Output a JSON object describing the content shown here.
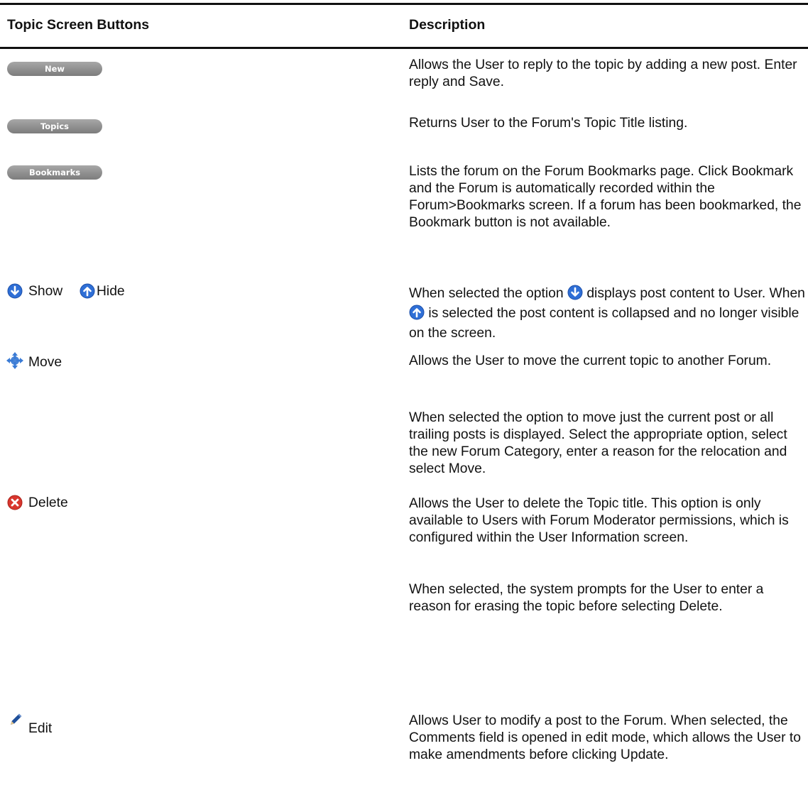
{
  "table": {
    "header": {
      "col1": "Topic Screen Buttons",
      "col2": "Description"
    },
    "rows": {
      "new": {
        "button_label": "New",
        "desc": "Allows the User to reply to the topic by adding a new post. Enter reply and Save."
      },
      "topics": {
        "button_label": "Topics",
        "desc": "Returns User to the Forum's Topic Title listing."
      },
      "bookmarks": {
        "button_label": "Bookmarks",
        "desc": "Lists the forum on the Forum Bookmarks page. Click Bookmark and the Forum is automatically recorded within the Forum>Bookmarks screen. If a forum has been bookmarked, the Bookmark button is not available."
      },
      "show_hide": {
        "show_label": "Show",
        "hide_label": "Hide",
        "desc_a": "When selected the option",
        "desc_b": "displays post content to User. When",
        "desc_c": "is selected the post content is collapsed and no longer visible on the screen."
      },
      "move": {
        "label": "Move",
        "desc": "Allows the User to move the current topic to another Forum.",
        "desc2": "When selected the option to move just the current post or all trailing posts is displayed. Select the appropriate option, select the new Forum Category, enter a reason for the relocation and select Move."
      },
      "delete": {
        "label": "Delete",
        "desc": "Allows the User to delete the Topic title. This option is only available to Users with Forum Moderator permissions, which is configured within the User Information screen.",
        "desc2": "When selected, the system prompts for the User to enter a reason for erasing the topic before selecting Delete."
      },
      "edit": {
        "label": "Edit",
        "desc": "Allows User to modify a post to the Forum. When selected, the Comments field is opened in edit mode, which allows the User to make amendments before clicking Update."
      }
    }
  },
  "icons": {
    "show": "arrow-down-circle-icon",
    "hide": "arrow-up-circle-icon",
    "move": "move-arrows-icon",
    "delete": "delete-x-circle-icon",
    "edit": "pencil-icon"
  },
  "colors": {
    "button_gray": "#8e8e8e",
    "icon_blue": "#2f6fd6",
    "delete_red": "#d9362e"
  }
}
